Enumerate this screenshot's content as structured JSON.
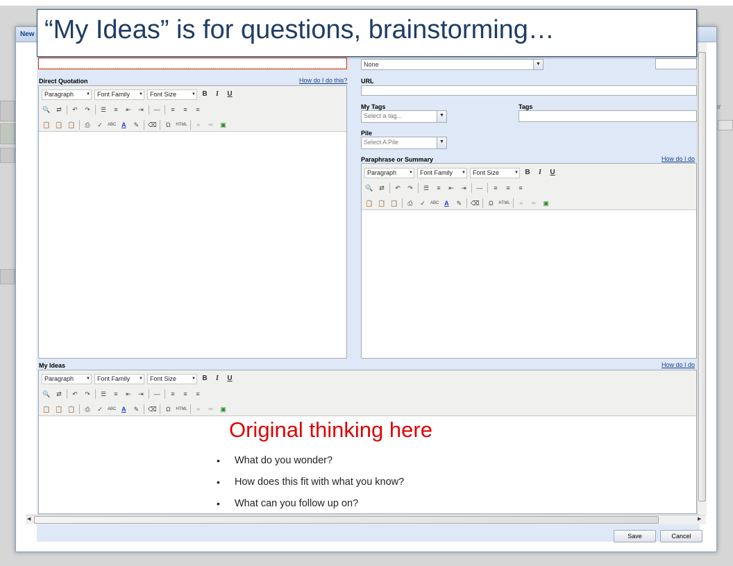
{
  "dialog": {
    "title": "New I",
    "top_field_value": "",
    "style_select": "None",
    "url_label": "URL",
    "my_tags_label": "My Tags",
    "tags_placeholder": "Select a tag...",
    "tags_label": "Tags",
    "pile_label": "Pile",
    "pile_placeholder": "Select A Pile"
  },
  "editors": {
    "direct": {
      "label": "Direct Quotation",
      "help": "How do I do this?"
    },
    "paraphrase": {
      "label": "Paraphrase or Summary",
      "help": "How do I do"
    },
    "ideas": {
      "label": "My Ideas",
      "help": "How do I do"
    }
  },
  "toolbar": {
    "format": "Paragraph",
    "font_family": "Font Family",
    "font_size": "Font Size",
    "bold": "B",
    "italic": "I",
    "underline": "U",
    "html": "HTML",
    "abc": "ABC",
    "omega": "Ω",
    "color_a": "A"
  },
  "buttons": {
    "save": "Save",
    "cancel": "Cancel"
  },
  "callout": {
    "text": "“My Ideas” is for questions, brainstorming…"
  },
  "overlay": {
    "title": "Original thinking here",
    "bullets": [
      "What do you wonder?",
      "How does this fit with what you know?",
      "What can you follow up on?"
    ]
  },
  "background": {
    "edge_text": "or"
  },
  "colors": {
    "accent": "#15428b",
    "panel_bg": "#dfe8f6",
    "overlay_title": "#e00000",
    "callout_text": "#1f3d63"
  }
}
